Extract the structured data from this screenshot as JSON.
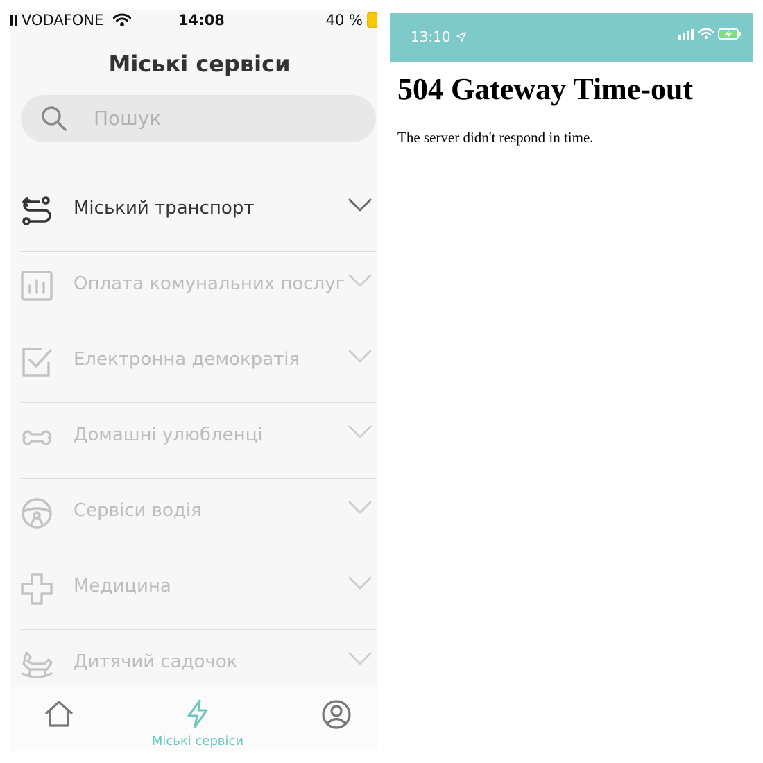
{
  "left_phone": {
    "status": {
      "carrier": "VODAFONE",
      "time": "14:08",
      "battery": "40 %",
      "battery_color": "#f7c800"
    },
    "title": "Міські сервіси",
    "search": {
      "placeholder": "Пошук"
    },
    "menu": [
      {
        "label": "Міський транспорт",
        "icon": "route-icon",
        "active": true
      },
      {
        "label": "Оплата комунальних послуг",
        "icon": "bar-chart-icon",
        "active": false
      },
      {
        "label": "Електронна демократія",
        "icon": "checkbox-icon",
        "active": false
      },
      {
        "label": "Домашні улюбленці",
        "icon": "bone-icon",
        "active": false
      },
      {
        "label": "Сервіси водія",
        "icon": "steering-wheel-icon",
        "active": false
      },
      {
        "label": "Медицина",
        "icon": "medical-cross-icon",
        "active": false
      },
      {
        "label": "Дитячий садочок",
        "icon": "rocking-horse-icon",
        "active": false
      }
    ],
    "tabbar": {
      "items": [
        {
          "name": "home-icon"
        },
        {
          "name": "lightning-icon",
          "label": "Міські сервіси",
          "active": true
        },
        {
          "name": "profile-icon"
        }
      ],
      "accent_color": "#6cc6c1"
    }
  },
  "right_phone": {
    "status": {
      "time": "13:10",
      "bar_color": "#7ecac8"
    },
    "error_title": "504 Gateway Time-out",
    "error_message": "The server didn't respond in time."
  }
}
